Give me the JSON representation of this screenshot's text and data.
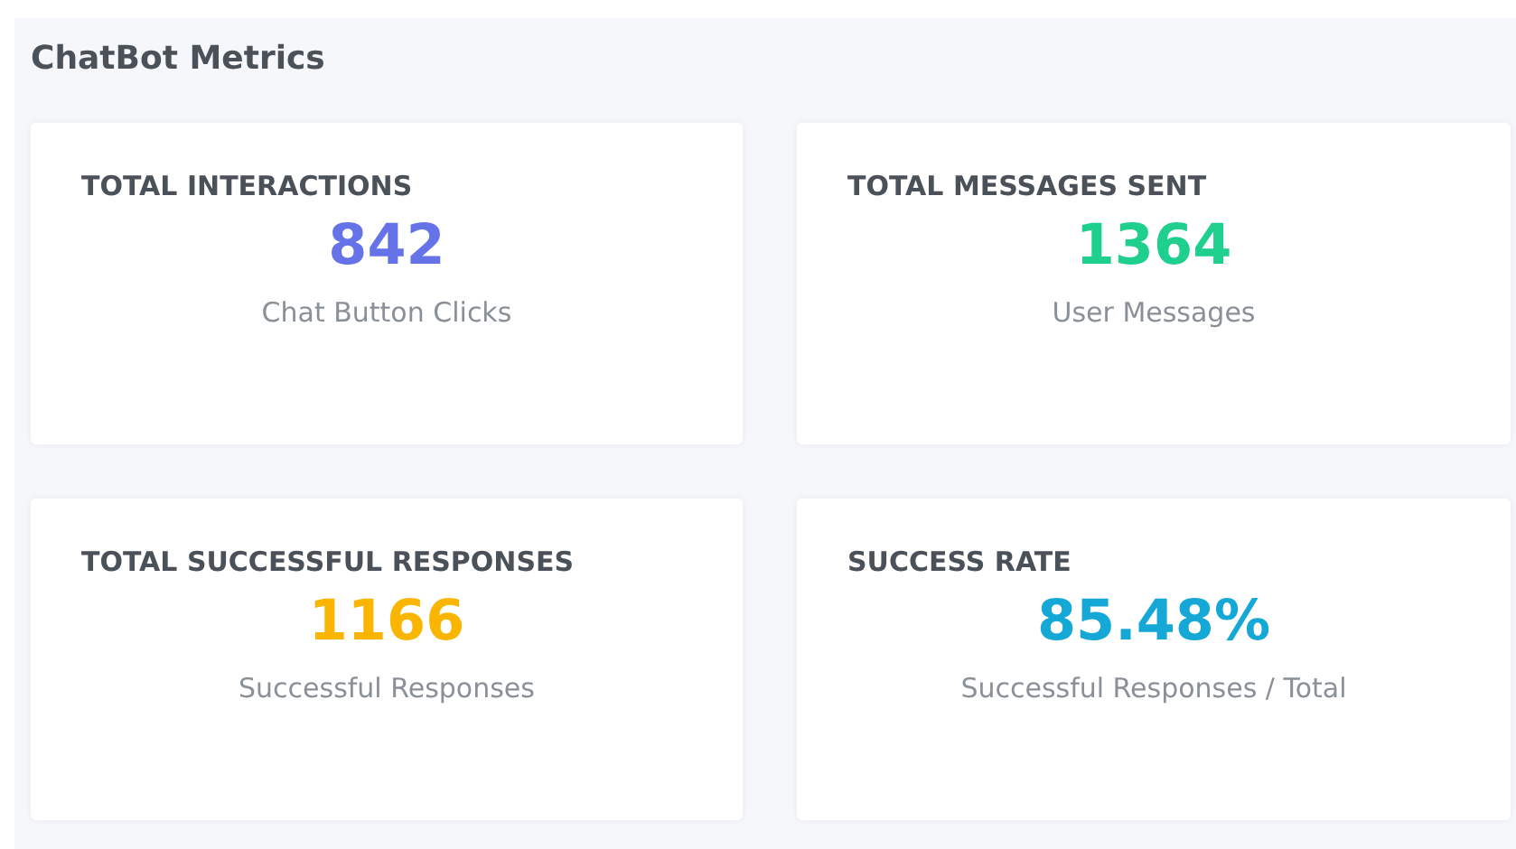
{
  "panel": {
    "title": "ChatBot Metrics"
  },
  "cards": [
    {
      "label": "TOTAL INTERACTIONS",
      "value": "842",
      "caption": "Chat Button Clicks",
      "color": "#6673e8"
    },
    {
      "label": "TOTAL MESSAGES SENT",
      "value": "1364",
      "caption": "User Messages",
      "color": "#1fcf8e"
    },
    {
      "label": "TOTAL SUCCESSFUL RESPONSES",
      "value": "1166",
      "caption": "Successful Responses",
      "color": "#f9b500"
    },
    {
      "label": "SUCCESS RATE",
      "value": "85.48%",
      "caption": "Successful Responses / Total",
      "color": "#15a8d6"
    }
  ]
}
